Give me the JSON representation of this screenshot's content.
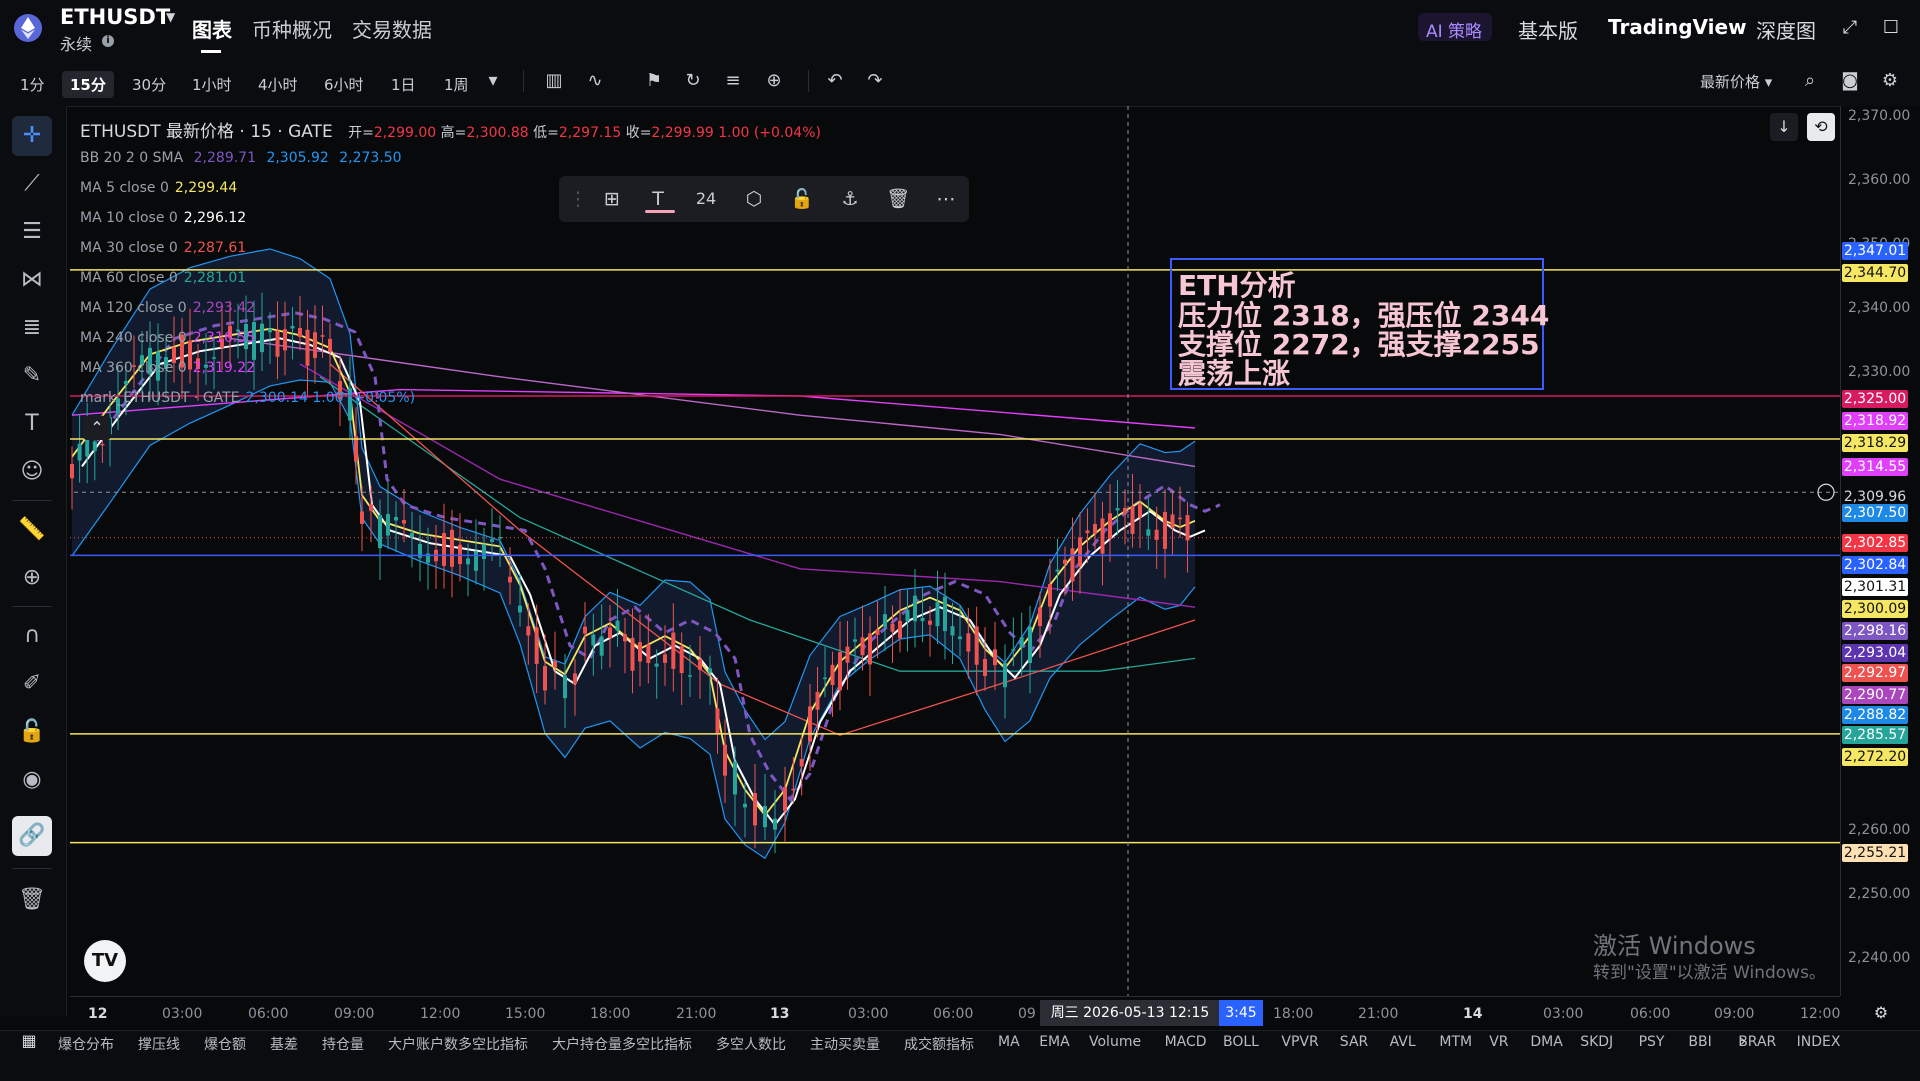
{
  "header": {
    "symbol": "ETHUSDT",
    "subtitle": "永续",
    "nav": [
      "图表",
      "币种概况",
      "交易数据"
    ],
    "ai_badge": "AI 策略",
    "right_links": [
      "基本版",
      "TradingView",
      "深度图"
    ]
  },
  "toolbar": {
    "intervals": [
      "1分",
      "15分",
      "30分",
      "1小时",
      "4小时",
      "6小时",
      "1日",
      "1周"
    ],
    "active_interval": "15分",
    "price_type": "最新价格"
  },
  "legend": {
    "title": "ETHUSDT 最新价格 · 15 · GATE",
    "open_label": "开",
    "open": "2,299.00",
    "high_label": "高",
    "high": "2,300.88",
    "low_label": "低",
    "low": "2,297.15",
    "close_label": "收",
    "close": "2,299.99",
    "change": "1.00 (+0.04%)",
    "bb": {
      "label": "BB 20 2 0 SMA",
      "v1": "2,289.71",
      "v2": "2,305.92",
      "v3": "2,273.50"
    },
    "ma5": {
      "label": "MA 5 close 0",
      "value": "2,299.44"
    },
    "ma10": {
      "label": "MA 10 close 0",
      "value": "2,296.12"
    },
    "ma30": {
      "label": "MA 30 close 0",
      "value": "2,287.61"
    },
    "ma60": {
      "label": "MA 60 close 0",
      "value": "2,281.01"
    },
    "ma120": {
      "label": "MA 120 close 0",
      "value": "2,293.42"
    },
    "ma240": {
      "label": "MA 240 close 0",
      "value": "2,316.55"
    },
    "ma360": {
      "label": "MA 360 close 0",
      "value": "2,319.22"
    },
    "mark": {
      "label": "mark_ETHUSDT · GATE",
      "value": "2,300.14 1.00 (+0.05%)"
    }
  },
  "drawing_toolbar": {
    "font_size": "24"
  },
  "annotation": {
    "line1": "ETH分析",
    "line2": "压力位 2318，强压位 2344",
    "line3": "支撑位 2272，强支撑2255",
    "line4": "震荡上涨"
  },
  "price_axis": {
    "ticks": [
      "2,370.00",
      "2,360.00",
      "2,350.00",
      "2,340.00",
      "2,330.00",
      "2,260.00",
      "2,250.00",
      "2,240.00"
    ],
    "labels": [
      {
        "text": "2,347.01",
        "bg": "#2962ff",
        "fg": "#ffffff"
      },
      {
        "text": "2,344.70",
        "bg": "#f5e663",
        "fg": "#111111"
      },
      {
        "text": "2,325.00",
        "bg": "#d81b60",
        "fg": "#ffffff"
      },
      {
        "text": "2,318.92",
        "bg": "#e040fb",
        "fg": "#ffffff"
      },
      {
        "text": "2,318.29",
        "bg": "#f5e663",
        "fg": "#111111"
      },
      {
        "text": "2,314.55",
        "bg": "#e040fb",
        "fg": "#ffffff"
      },
      {
        "text": "2,309.96",
        "bg": "#08090b",
        "fg": "#d7dae0"
      },
      {
        "text": "2,307.50",
        "bg": "#1e88e5",
        "fg": "#ffffff"
      },
      {
        "text": "2,302.85",
        "bg": "#f23645",
        "fg": "#ffffff"
      },
      {
        "text": "2,302.84",
        "bg": "#2962ff",
        "fg": "#ffffff"
      },
      {
        "text": "2,301.31",
        "bg": "#ffffff",
        "fg": "#111111"
      },
      {
        "text": "2,300.09",
        "bg": "#f5e663",
        "fg": "#111111"
      },
      {
        "text": "2,298.16",
        "bg": "#7e57c2",
        "fg": "#ffffff"
      },
      {
        "text": "2,293.04",
        "bg": "#5e35b1",
        "fg": "#ffffff"
      },
      {
        "text": "2,292.97",
        "bg": "#ef5350",
        "fg": "#ffffff"
      },
      {
        "text": "2,290.77",
        "bg": "#ab47bc",
        "fg": "#ffffff"
      },
      {
        "text": "2,288.82",
        "bg": "#1e88e5",
        "fg": "#ffffff"
      },
      {
        "text": "2,285.57",
        "bg": "#26a69a",
        "fg": "#ffffff"
      },
      {
        "text": "2,272.20",
        "bg": "#f5e663",
        "fg": "#111111"
      },
      {
        "text": "2,255.21",
        "bg": "#ffe0b2",
        "fg": "#111111"
      }
    ]
  },
  "time_axis": {
    "ticks": [
      "12",
      "03:00",
      "06:00",
      "09:00",
      "12:00",
      "15:00",
      "18:00",
      "21:00",
      "13",
      "03:00",
      "06:00",
      "09",
      "18:00",
      "21:00",
      "14",
      "03:00",
      "06:00",
      "09:00",
      "12:00"
    ],
    "cross_date": "周三 2026-05-13   12:15",
    "cross_time": "3:45"
  },
  "indicators": [
    "爆仓分布",
    "撑压线",
    "爆仓额",
    "基差",
    "持仓量",
    "大户账户数多空比指标",
    "大户持仓量多空比指标",
    "多空人数比",
    "主动买卖量",
    "成交额指标",
    "MA",
    "EMA",
    "Volume",
    "MACD",
    "BOLL",
    "VPVR",
    "SAR",
    "AVL",
    "MTM",
    "VR",
    "DMA",
    "SKDJ",
    "PSY",
    "BBI",
    "BRAR",
    "INDEX"
  ],
  "watermark": {
    "line1": "激活 Windows",
    "line2": "转到\"设置\"以激活 Windows。"
  },
  "tv_logo": "TV"
}
